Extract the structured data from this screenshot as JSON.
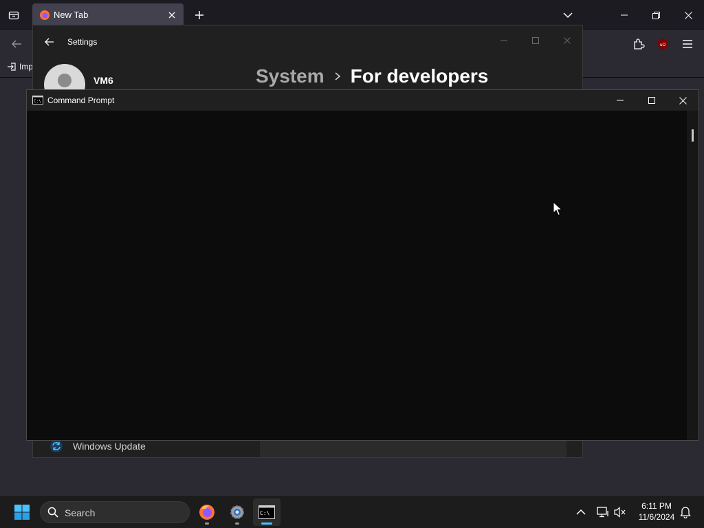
{
  "firefox": {
    "tab_title": "New Tab",
    "bookmark_label": "Imp"
  },
  "settings": {
    "app_title": "Settings",
    "user_name": "VM6",
    "breadcrumb_parent": "System",
    "breadcrumb_separator": "›",
    "breadcrumb_current": "For developers",
    "nav_windows_update": "Windows Update"
  },
  "cmd": {
    "title": "Command Prompt"
  },
  "taskbar": {
    "search_placeholder": "Search",
    "time": "6:11 PM",
    "date": "11/6/2024"
  },
  "colors": {
    "accent": "#0078d4",
    "cmd_background": "#0c0c0c",
    "firefox_orange": "#ff7139",
    "ublock_red": "#800000"
  }
}
